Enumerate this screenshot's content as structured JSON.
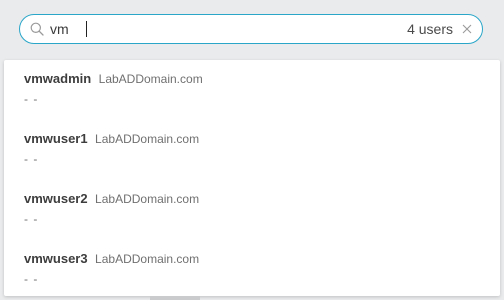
{
  "search": {
    "value": "vm",
    "result_count": "4 users"
  },
  "results": [
    {
      "name": "vmwadmin",
      "domain": "LabADDomain.com",
      "detail": "- -"
    },
    {
      "name": "vmwuser1",
      "domain": "LabADDomain.com",
      "detail": "- -"
    },
    {
      "name": "vmwuser2",
      "domain": "LabADDomain.com",
      "detail": "- -"
    },
    {
      "name": "vmwuser3",
      "domain": "LabADDomain.com",
      "detail": "- -"
    }
  ],
  "icons": {
    "search": "search-icon",
    "clear": "close-icon"
  },
  "colors": {
    "accent": "#2aa6c9"
  }
}
